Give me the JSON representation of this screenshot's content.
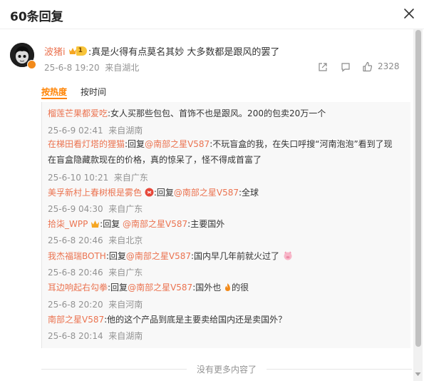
{
  "header": {
    "title": "60条回复"
  },
  "main": {
    "username": "波猪i",
    "level": "1",
    "content": ":真是火得有点莫名其妙 大多数都是跟风的罢了",
    "time": "25-6-8 19:20",
    "location": "来自湖北",
    "likes": "2328"
  },
  "tabs": [
    "按热度",
    "按时间"
  ],
  "replies": [
    {
      "user": "榴莲芒果都爱吃",
      "text": ":女人买那些包包、首饰不也是跟风。200的包卖20万一个",
      "time": "25-6-9 02:41",
      "location": "来自湖南"
    },
    {
      "user": "在梯田看灯塔的狸猫",
      "pre": ":回复",
      "at": "@南部之星V587",
      "text": ":不玩盲盒的我，在失口呼搜“河南泡泡”看到了现在盲盒隐藏款现在的价格，真的惊呆了，怪不得成首富了",
      "time": "25-6-10 10:21",
      "location": "来自广东"
    },
    {
      "user": "美孚新村上春树根是雾色",
      "pre": ":回复",
      "at": "@南部之星V587",
      "text": ":全球",
      "time": "25-6-9 04:30",
      "location": "来自广东"
    },
    {
      "user": "拾柒_WPP",
      "pre": ":回复 ",
      "at": "@南部之星V587",
      "text": ":主要国外",
      "time": "25-6-8 20:46",
      "location": "来自北京"
    },
    {
      "user": "我杰福瑞BOTH",
      "pre": ":回复",
      "at": "@南部之星V587",
      "text": ":国内早几年前就火过了",
      "time": "25-6-8 20:46",
      "location": "来自广东"
    },
    {
      "user": "耳边响起右勾拳",
      "pre": ":回复",
      "at": "@南部之星V587",
      "text": ":国外也",
      "text2": "的很",
      "time": "25-6-8 20:20",
      "location": "来自河南"
    },
    {
      "user": "南部之星V587",
      "text": ":他的这个产品到底是主要卖给国内还是卖国外？",
      "time": "25-6-8 20:14",
      "location": "来自湖南"
    }
  ],
  "footer": {
    "no_more": "没有更多内容了"
  },
  "colors": {
    "accent": "#ff8200",
    "username": "#eb7350",
    "meta": "#939393"
  }
}
